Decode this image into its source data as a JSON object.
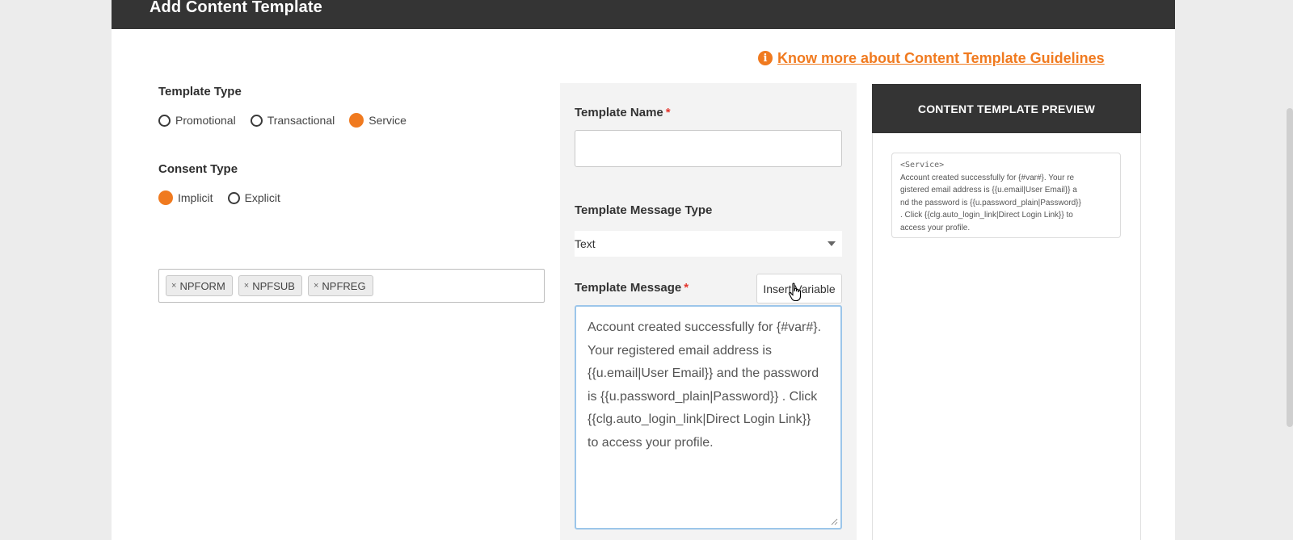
{
  "header": {
    "title": "Add Content Template"
  },
  "guidelines": {
    "icon": "info-icon",
    "link_text": "Know more about Content Template Guidelines",
    "color": "#f07a1f"
  },
  "template_type": {
    "label": "Template Type",
    "options": [
      {
        "label": "Promotional",
        "checked": false
      },
      {
        "label": "Transactional",
        "checked": false
      },
      {
        "label": "Service",
        "checked": true
      }
    ]
  },
  "consent_type": {
    "label": "Consent Type",
    "options": [
      {
        "label": "Implicit",
        "checked": true
      },
      {
        "label": "Explicit",
        "checked": false
      }
    ]
  },
  "tags": [
    "NPFORM",
    "NPFSUB",
    "NPFREG"
  ],
  "form": {
    "name_label": "Template Name",
    "name_value": "",
    "required_mark": "*",
    "message_type_label": "Template Message Type",
    "message_type_value": "Text",
    "message_label": "Template Message",
    "insert_variable": "Insert Variable",
    "message_lines": [
      "Account created successfully for {#var#}.",
      "Your registered email address is",
      "{{u.email|User Email}} and the password",
      "is {{u.password_plain|Password}} . Click",
      "{{clg.auto_login_link|Direct Login Link}}",
      "to access your profile."
    ]
  },
  "preview": {
    "title": "CONTENT TEMPLATE PREVIEW",
    "tag": "<Service>",
    "lines": [
      "Account created successfully for {#var#}. Your re",
      "gistered email address is {{u.email|User Email}} a",
      "nd the password is {{u.password_plain|Password}}",
      ". Click {{clg.auto_login_link|Direct Login Link}} to",
      "access your profile."
    ]
  },
  "colors": {
    "accent": "#f07a1f",
    "header": "#343434",
    "required": "#e4362e"
  }
}
